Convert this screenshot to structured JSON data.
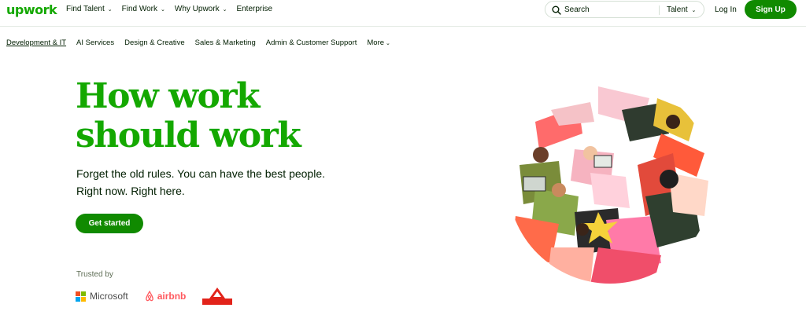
{
  "brand": {
    "logo_text": "upwork",
    "accent": "#14a800",
    "button_color": "#108a00"
  },
  "nav": {
    "items": [
      {
        "label": "Find Talent",
        "has_dropdown": true
      },
      {
        "label": "Find Work",
        "has_dropdown": true
      },
      {
        "label": "Why Upwork",
        "has_dropdown": true
      },
      {
        "label": "Enterprise",
        "has_dropdown": false
      }
    ],
    "search": {
      "placeholder": "Search",
      "scope": "Talent"
    },
    "login_label": "Log In",
    "signup_label": "Sign Up"
  },
  "categories": [
    {
      "label": "Development & IT",
      "active": true
    },
    {
      "label": "AI Services"
    },
    {
      "label": "Design & Creative"
    },
    {
      "label": "Sales & Marketing"
    },
    {
      "label": "Admin & Customer Support"
    },
    {
      "label": "More",
      "has_dropdown": true
    }
  ],
  "hero": {
    "title_line1": "How work",
    "title_line2": "should work",
    "subtitle_line1": "Forget the old rules. You can have the best people.",
    "subtitle_line2": "Right now. Right here.",
    "cta_label": "Get started"
  },
  "trusted": {
    "label": "Trusted by",
    "logos": [
      {
        "name": "Microsoft"
      },
      {
        "name": "airbnb"
      },
      {
        "name": "bissell"
      }
    ]
  },
  "icons": {
    "search": "search-icon",
    "caret": "chevron-down-icon"
  }
}
